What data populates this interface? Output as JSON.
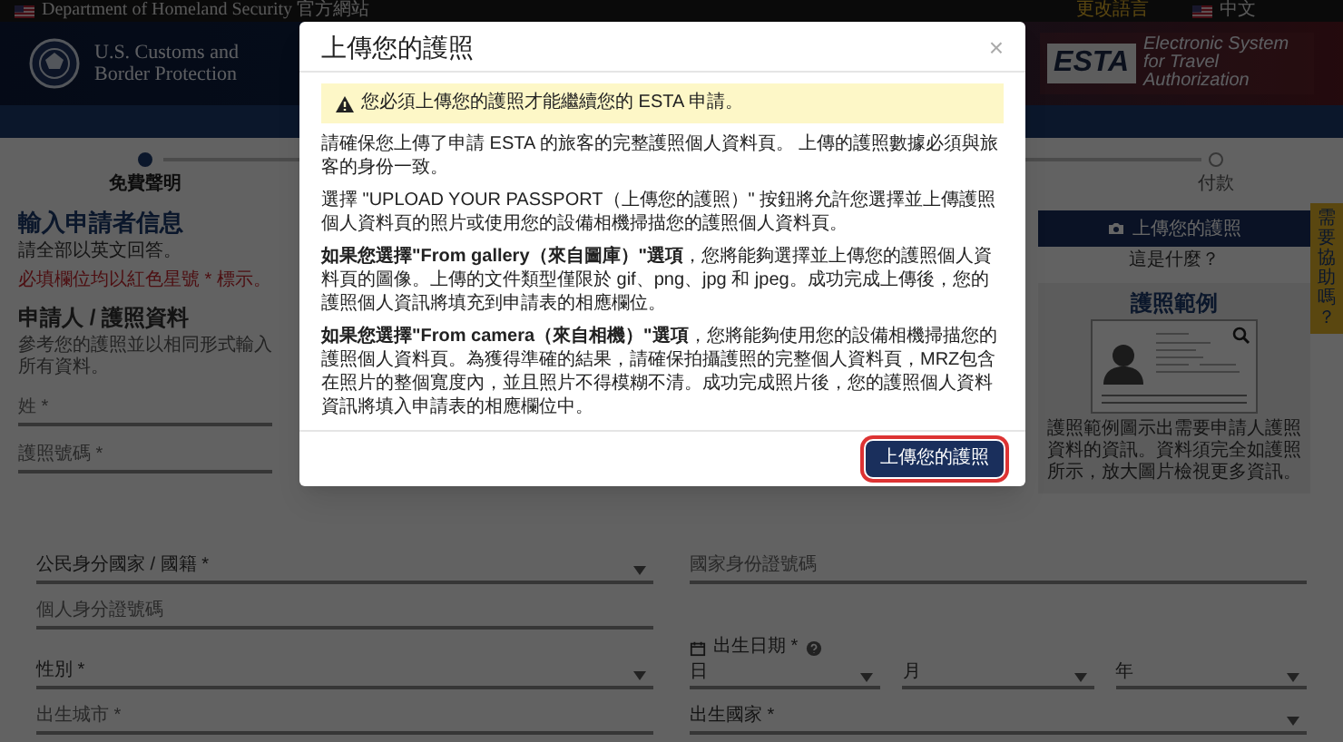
{
  "top_bar": {
    "agency": "Department of Homeland Security 官方網站",
    "language_link": "更改語言",
    "language": "中文"
  },
  "header": {
    "agency_name": "U.S. Customs and Border Protection",
    "logo_text": "ESTA",
    "logo_tagline": "Electronic System for Travel Authorization"
  },
  "steps": [
    {
      "label": "免費聲明",
      "done": true
    },
    {
      "label": "付款",
      "done": false
    }
  ],
  "form": {
    "title": "輸入申請者信息",
    "notes": [
      {
        "kind": "info",
        "text": "請全部以英文回答。"
      },
      {
        "kind": "required",
        "text": "必填欄位均以紅色星號 * 標示。"
      }
    ],
    "section": "申請人 / 護照資料",
    "section_note": "參考您的護照並以相同形式輸入所有資料。",
    "fields": [
      {
        "kind": "text",
        "label": "姓 *"
      },
      {
        "kind": "text",
        "label": "護照號碼 *"
      }
    ]
  },
  "lower_rows": [
    [
      {
        "kind": "select",
        "label": "公民身分國家 / 國籍 *"
      },
      {
        "kind": "text",
        "label": "國家身份證號碼"
      }
    ],
    [
      {
        "kind": "text",
        "label": "個人身分證號碼"
      }
    ],
    [
      {
        "kind": "select",
        "label": "性別 *"
      },
      {
        "kind": "date",
        "label": "出生日期 *",
        "parts": [
          "日",
          "月",
          "年"
        ]
      }
    ],
    [
      {
        "kind": "text",
        "label": "出生城市 *"
      },
      {
        "kind": "select",
        "label": "出生國家 *"
      }
    ]
  ],
  "passport_upload": {
    "button": "上傳您的護照",
    "help_link": "這是什麼？",
    "example_title": "護照範例",
    "example_caption": "護照範例圖示出需要申請人護照資料的資訊。資料須完全如護照所示，放大圖片檢視更多資訊。"
  },
  "help_tab": "需要協助嗎？",
  "modal": {
    "title": "上傳您的護照",
    "close": "×",
    "alert": "您必須上傳您的護照才能繼續您的 ESTA 申請。",
    "paragraphs": [
      "請確保您上傳了申請 ESTA 的旅客的完整護照個人資料頁。 上傳的護照數據必須與旅客的身份一致。",
      "選擇 \"UPLOAD YOUR PASSPORT（上傳您的護照）\" 按鈕將允許您選擇並上傳護照個人資料頁的照片或使用您的設備相機掃描您的護照個人資料頁。",
      "**如果您選擇\"From gallery（來自圖庫）\"選項**，您將能夠選擇並上傳您的護照個人資料頁的圖像。上傳的文件類型僅限於 gif、png、jpg 和 jpeg。成功完成上傳後，您的護照個人資訊將填充到申請表的相應欄位。",
      "**如果您選擇\"From camera（來自相機）\"選項**，您將能夠使用您的設備相機掃描您的護照個人資料頁。為獲得準確的結果，請確保拍攝護照的完整個人資料頁，MRZ包含在照片的整個寬度內，並且照片不得模糊不清。成功完成照片後，您的護照個人資料資訊將填入申請表的相應欄位中。"
    ],
    "button": "上傳您的護照"
  }
}
